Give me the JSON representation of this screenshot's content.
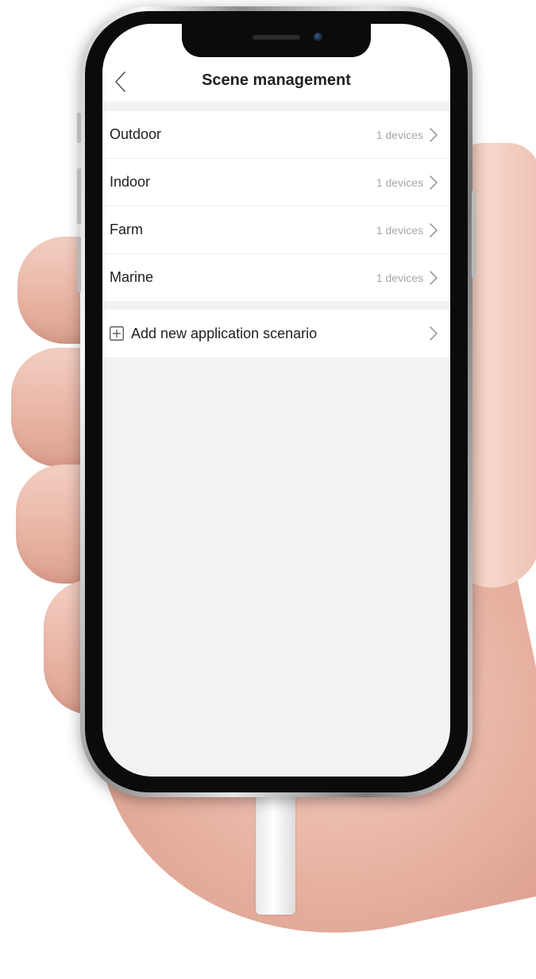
{
  "navbar": {
    "title": "Scene management",
    "back_icon": "chevron-left-icon"
  },
  "scenes": [
    {
      "name": "Outdoor",
      "count": "1 devices"
    },
    {
      "name": "Indoor",
      "count": "1 devices"
    },
    {
      "name": "Farm",
      "count": "1 devices"
    },
    {
      "name": "Marine",
      "count": "1 devices"
    }
  ],
  "add_scene": {
    "label": "Add new application scenario",
    "icon": "plus-square-icon"
  },
  "colors": {
    "background": "#f2f2f2",
    "card": "#ffffff",
    "text_primary": "#1f1f1f",
    "text_secondary": "#a6a6a6",
    "chevron": "#8a8a8a"
  }
}
